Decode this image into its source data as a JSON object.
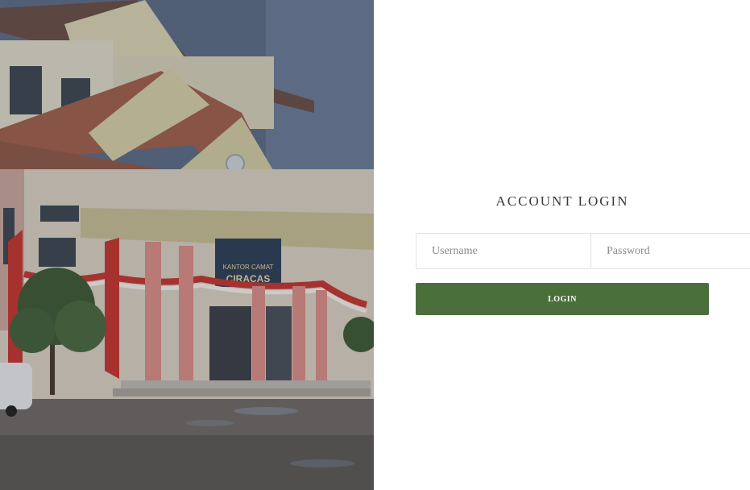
{
  "login": {
    "title": "ACCOUNT LOGIN",
    "username_placeholder": "Username",
    "password_placeholder": "Password",
    "button_label": "LOGIN"
  },
  "photo": {
    "sign_line1": "KANTOR CAMAT",
    "sign_line2": "CIRACAS"
  },
  "colors": {
    "button_bg": "#4a6f3a",
    "title_text": "#3a3a3a"
  }
}
